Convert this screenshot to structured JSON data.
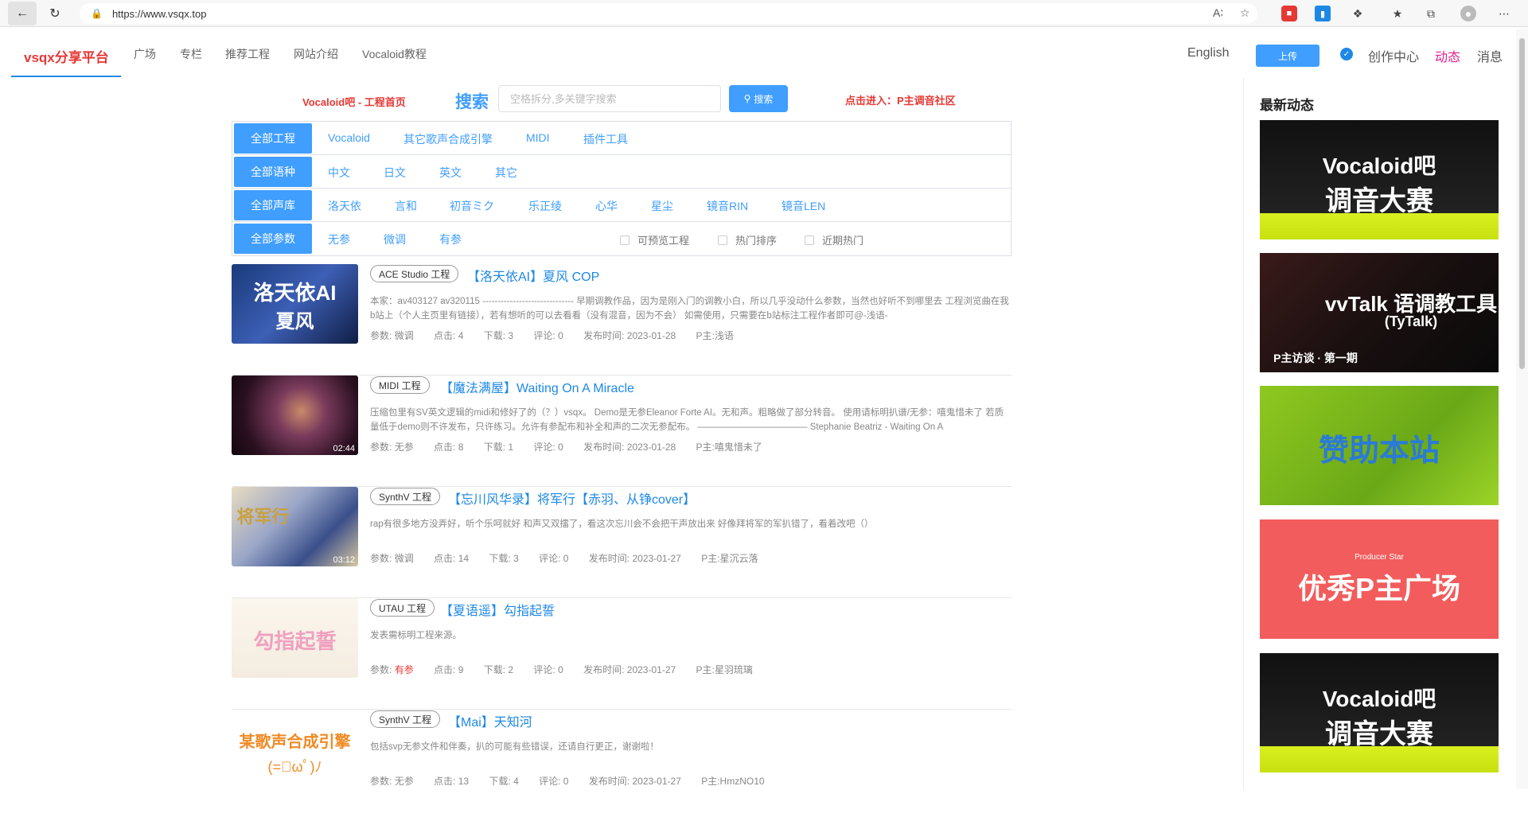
{
  "browser": {
    "url": "https://www.vsqx.top"
  },
  "header": {
    "logo": "vsqx分享平台",
    "nav": [
      "广场",
      "专栏",
      "推荐工程",
      "网站介绍",
      "Vocaloid教程"
    ],
    "language": "English",
    "upload": "上传",
    "creator_center": "创作中心",
    "activity": "动态",
    "messages": "消息",
    "colors": {
      "accent": "#409eff",
      "logo": "#e53935",
      "activity": "#e0208c"
    }
  },
  "search": {
    "promo_left": "Vocaloid吧 - 工程首页",
    "label": "搜索",
    "placeholder": "空格拆分,多关键字搜索",
    "button": "搜索",
    "promo_right": "点击进入：P主调音社区"
  },
  "filters": {
    "rows": [
      {
        "head": "全部工程",
        "options": [
          "Vocaloid",
          "其它歌声合成引擎",
          "MIDI",
          "插件工具"
        ]
      },
      {
        "head": "全部语种",
        "options": [
          "中文",
          "日文",
          "英文",
          "其它"
        ]
      },
      {
        "head": "全部声库",
        "options": [
          "洛天依",
          "言和",
          "初音ミク",
          "乐正绫",
          "心华",
          "星尘",
          "镜音RIN",
          "镜音LEN"
        ]
      },
      {
        "head": "全部参数",
        "options": [
          "无参",
          "微调",
          "有参"
        ]
      }
    ],
    "checkboxes": [
      "可预览工程",
      "热门排序",
      "近期热门"
    ]
  },
  "items": [
    {
      "tag": "ACE Studio 工程",
      "title": "【洛天依AI】夏风 COP",
      "desc": "本家：av403127 av320115 ------------------------------ 早期调教作品，因为是刚入门的调教小白，所以几乎没动什么参数，当然也好听不到哪里去 工程浏览曲在我b站上（个人主页里有链接），若有想听的可以去看看（没有混音，因为不会） 如需使用，只需要在b站标注工程作者即可@-浅语-",
      "param_label": "参数:",
      "param": "微调",
      "clicks": "点击: 4",
      "downloads": "下载: 3",
      "comments": "评论: 0",
      "date": "发布时间: 2023-01-28",
      "author": "P主:浅语",
      "thumb_text": [
        "洛天依AI",
        "夏风"
      ],
      "duration": ""
    },
    {
      "tag": "MIDI 工程",
      "title": "【魔法满屋】Waiting On A Miracle",
      "desc": "压缩包里有SV英文逻辑的midi和修好了的（？）vsqx。 Demo是无参Eleanor Forte AI。无和声。粗略做了部分转音。 使用请标明扒谱/无参：嘻鬼惜未了 若质量低于demo则不许发布，只许练习。允许有参配布和补全和声的二次无参配布。 ———————————— Stephanie Beatriz - Waiting On A",
      "param_label": "参数:",
      "param": "无参",
      "clicks": "点击: 8",
      "downloads": "下载: 1",
      "comments": "评论: 0",
      "date": "发布时间: 2023-01-28",
      "author": "P主:嘻鬼惜未了",
      "thumb_text": [],
      "duration": "02:44"
    },
    {
      "tag": "SynthV 工程",
      "title": "【忘川风华录】将军行【赤羽、从铮cover】",
      "desc": "rap有很多地方没弄好，听个乐呵就好 和声又双擂了，看这次忘川会不会把干声放出来 好像拜将军的军扒错了，看着改吧（）",
      "param_label": "参数:",
      "param": "微调",
      "clicks": "点击: 14",
      "downloads": "下载: 3",
      "comments": "评论: 0",
      "date": "发布时间: 2023-01-27",
      "author": "P主:星沉云落",
      "thumb_text": [
        "将军行"
      ],
      "duration": "03:12"
    },
    {
      "tag": "UTAU 工程",
      "title": "【夏语遥】勾指起誓",
      "desc": "发表需标明工程来源。",
      "param_label": "参数:",
      "param": "有参",
      "clicks": "点击: 9",
      "downloads": "下载: 2",
      "comments": "评论: 0",
      "date": "发布时间: 2023-01-27",
      "author": "P主:星羽琉璃",
      "thumb_text": [
        "勾指起誓"
      ],
      "duration": ""
    },
    {
      "tag": "SynthV 工程",
      "title": "【Mai】天知河",
      "desc": "包括svp无参文件和伴奏，扒的可能有些错误，还请自行更正，谢谢啦！",
      "param_label": "参数:",
      "param": "无参",
      "clicks": "点击: 13",
      "downloads": "下载: 4",
      "comments": "评论: 0",
      "date": "发布时间: 2023-01-27",
      "author": "P主:HmzNO10",
      "thumb_text": [
        "某歌声合成引擎",
        "(=ﾟωﾟ)ﾉ"
      ],
      "duration": ""
    }
  ],
  "sidebar": {
    "title": "最新动态",
    "banners": [
      {
        "line1": "Vocaloid吧",
        "line2": "调音大赛",
        "line3": ""
      },
      {
        "line1": "vvTalk 语调教工具",
        "line2": "(TyTalk)",
        "line3": "P主访谈 · 第一期"
      },
      {
        "line1": "赞助本站",
        "line2": "",
        "line3": ""
      },
      {
        "line1": "Producer Star",
        "line2": "优秀P主广场",
        "line3": ""
      },
      {
        "line1": "Vocaloid吧",
        "line2": "调音大赛",
        "line3": ""
      }
    ]
  }
}
